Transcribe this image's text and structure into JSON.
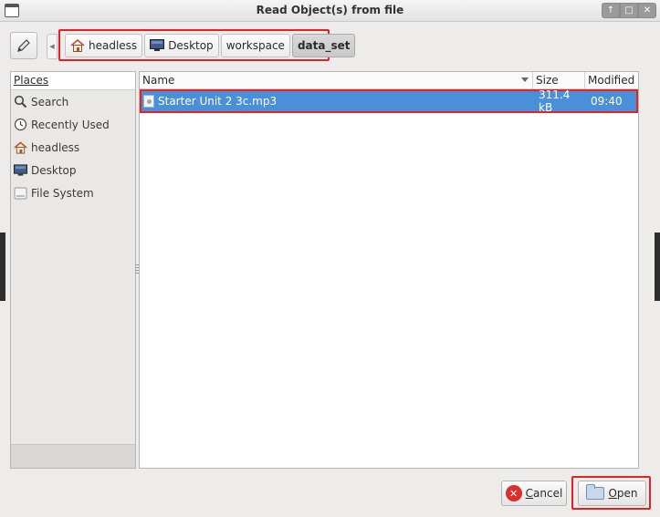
{
  "window": {
    "title": "Read Object(s) from file",
    "controls": [
      "↑",
      "□",
      "✕"
    ]
  },
  "pathbar": {
    "crumbs": [
      {
        "label": "headless",
        "icon": "home-icon"
      },
      {
        "label": "Desktop",
        "icon": "desktop-icon"
      },
      {
        "label": "workspace"
      },
      {
        "label": "data_set",
        "active": true
      }
    ]
  },
  "places": {
    "header": "Places",
    "items": [
      {
        "label": "Search",
        "icon": "search-icon"
      },
      {
        "label": "Recently Used",
        "icon": "clock-icon"
      },
      {
        "label": "headless",
        "icon": "home-icon"
      },
      {
        "label": "Desktop",
        "icon": "desktop-icon"
      },
      {
        "label": "File System",
        "icon": "drive-icon"
      }
    ]
  },
  "filelist": {
    "columns": {
      "name": "Name",
      "size": "Size",
      "modified": "Modified"
    },
    "rows": [
      {
        "name": "Starter Unit 2 3c.mp3",
        "size": "311.4 kB",
        "modified": "09:40",
        "selected": true
      }
    ]
  },
  "buttons": {
    "cancel_label_underlined": "C",
    "cancel_label_rest": "ancel",
    "open_label_underlined": "O",
    "open_label_rest": "pen"
  },
  "colors": {
    "selection": "#4a90d9",
    "highlight_box": "#e8201f"
  }
}
